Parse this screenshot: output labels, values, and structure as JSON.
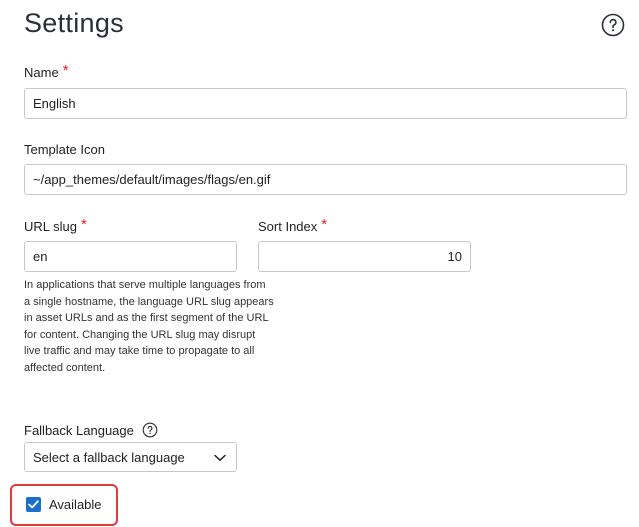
{
  "page": {
    "title": "Settings",
    "help_icon": "question-circle-icon"
  },
  "fields": {
    "name": {
      "label": "Name",
      "required_mark": "*",
      "value": "English"
    },
    "template_icon": {
      "label": "Template Icon",
      "value": "~/app_themes/default/images/flags/en.gif"
    },
    "url_slug": {
      "label": "URL slug",
      "required_mark": "*",
      "value": "en",
      "help": "In applications that serve multiple languages from a single hostname, the language URL slug appears in asset URLs and as the first segment of the URL for content. Changing the URL slug may disrupt live traffic and may take time to propagate to all affected content."
    },
    "sort_index": {
      "label": "Sort Index",
      "required_mark": "*",
      "value": "10"
    },
    "fallback_language": {
      "label": "Fallback Language",
      "help_icon": "question-circle-icon",
      "selected": "Select a fallback language",
      "chevron_icon": "chevron-down-icon"
    },
    "available": {
      "label": "Available",
      "checked": true
    }
  },
  "colors": {
    "required": "#d9261c",
    "checkbox": "#1a6fcc",
    "highlight_border": "#e03a3a",
    "input_border": "#c4c7cc"
  }
}
